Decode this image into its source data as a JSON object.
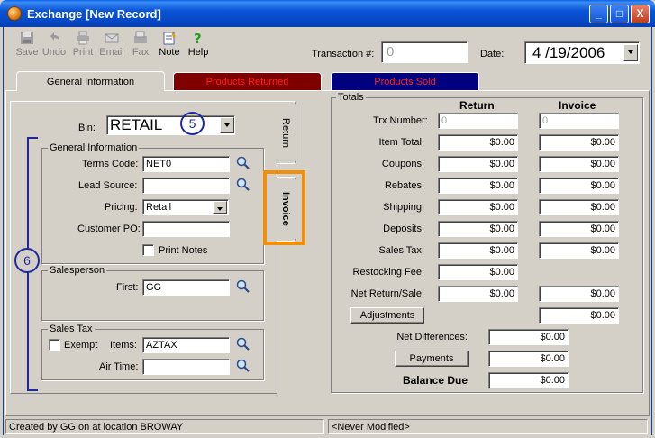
{
  "window": {
    "title": "Exchange [New Record]",
    "controls": {
      "minimize": "_",
      "maximize": "□",
      "close": "X"
    }
  },
  "toolbar": {
    "items": [
      {
        "label": "Save",
        "icon": "save-icon",
        "enabled": false
      },
      {
        "label": "Undo",
        "icon": "undo-icon",
        "enabled": false
      },
      {
        "label": "Print",
        "icon": "print-icon",
        "enabled": false
      },
      {
        "label": "Email",
        "icon": "email-icon",
        "enabled": false
      },
      {
        "label": "Fax",
        "icon": "fax-icon",
        "enabled": false
      },
      {
        "label": "Note",
        "icon": "note-icon",
        "enabled": true
      },
      {
        "label": "Help",
        "icon": "help-icon",
        "enabled": true
      }
    ],
    "transaction_label": "Transaction #:",
    "transaction_value": "0",
    "date_label": "Date:",
    "date_value": "4 /19/2006"
  },
  "tabs": {
    "general": "General Information",
    "returned": "Products Returned",
    "sold": "Products Sold"
  },
  "left": {
    "bin_label": "Bin:",
    "bin_value": "RETAIL",
    "callout_5": "5",
    "callout_6": "6",
    "general_group": "General Information",
    "terms_label": "Terms Code:",
    "terms_value": "NET0",
    "lead_label": "Lead Source:",
    "lead_value": "",
    "pricing_label": "Pricing:",
    "pricing_value": "Retail",
    "po_label": "Customer PO:",
    "po_value": "",
    "print_notes": "Print Notes",
    "sales_group": "Salesperson",
    "first_label": "First:",
    "first_value": "GG",
    "tax_group": "Sales Tax",
    "exempt": "Exempt",
    "items_label": "Items:",
    "items_value": "AZTAX",
    "airtime_label": "Air Time:",
    "airtime_value": ""
  },
  "side_tabs": {
    "return": "Return",
    "invoice": "Invoice"
  },
  "totals": {
    "group": "Totals",
    "col_return": "Return",
    "col_invoice": "Invoice",
    "trx_label": "Trx Number:",
    "trx_return": "0",
    "trx_invoice": "0",
    "rows": [
      {
        "label": "Item Total:",
        "return": "$0.00",
        "invoice": "$0.00"
      },
      {
        "label": "Coupons:",
        "return": "$0.00",
        "invoice": "$0.00"
      },
      {
        "label": "Rebates:",
        "return": "$0.00",
        "invoice": "$0.00"
      },
      {
        "label": "Shipping:",
        "return": "$0.00",
        "invoice": "$0.00"
      },
      {
        "label": "Deposits:",
        "return": "$0.00",
        "invoice": "$0.00"
      },
      {
        "label": "Sales Tax:",
        "return": "$0.00",
        "invoice": "$0.00"
      }
    ],
    "restocking_label": "Restocking Fee:",
    "restocking_value": "$0.00",
    "net_label": "Net Return/Sale:",
    "net_return": "$0.00",
    "net_invoice": "$0.00",
    "adjustments_button": "Adjustments",
    "adjustments_value": "$0.00",
    "net_diff_label": "Net Differences:",
    "net_diff_value": "$0.00",
    "payments_button": "Payments",
    "payments_value": "$0.00",
    "balance_label": "Balance Due",
    "balance_value": "$0.00"
  },
  "status": {
    "left": "Created by GG on  at location BROWAY",
    "right": "<Never Modified>"
  },
  "colors": {
    "titlebar": "#0a54d6",
    "tab_returned_bg": "#800000",
    "tab_returned_text": "#ff2020",
    "tab_sold_bg": "#000080",
    "tab_sold_text": "#ff2020",
    "callout_blue": "#1e2a9c",
    "highlight_orange": "#f0900a"
  }
}
